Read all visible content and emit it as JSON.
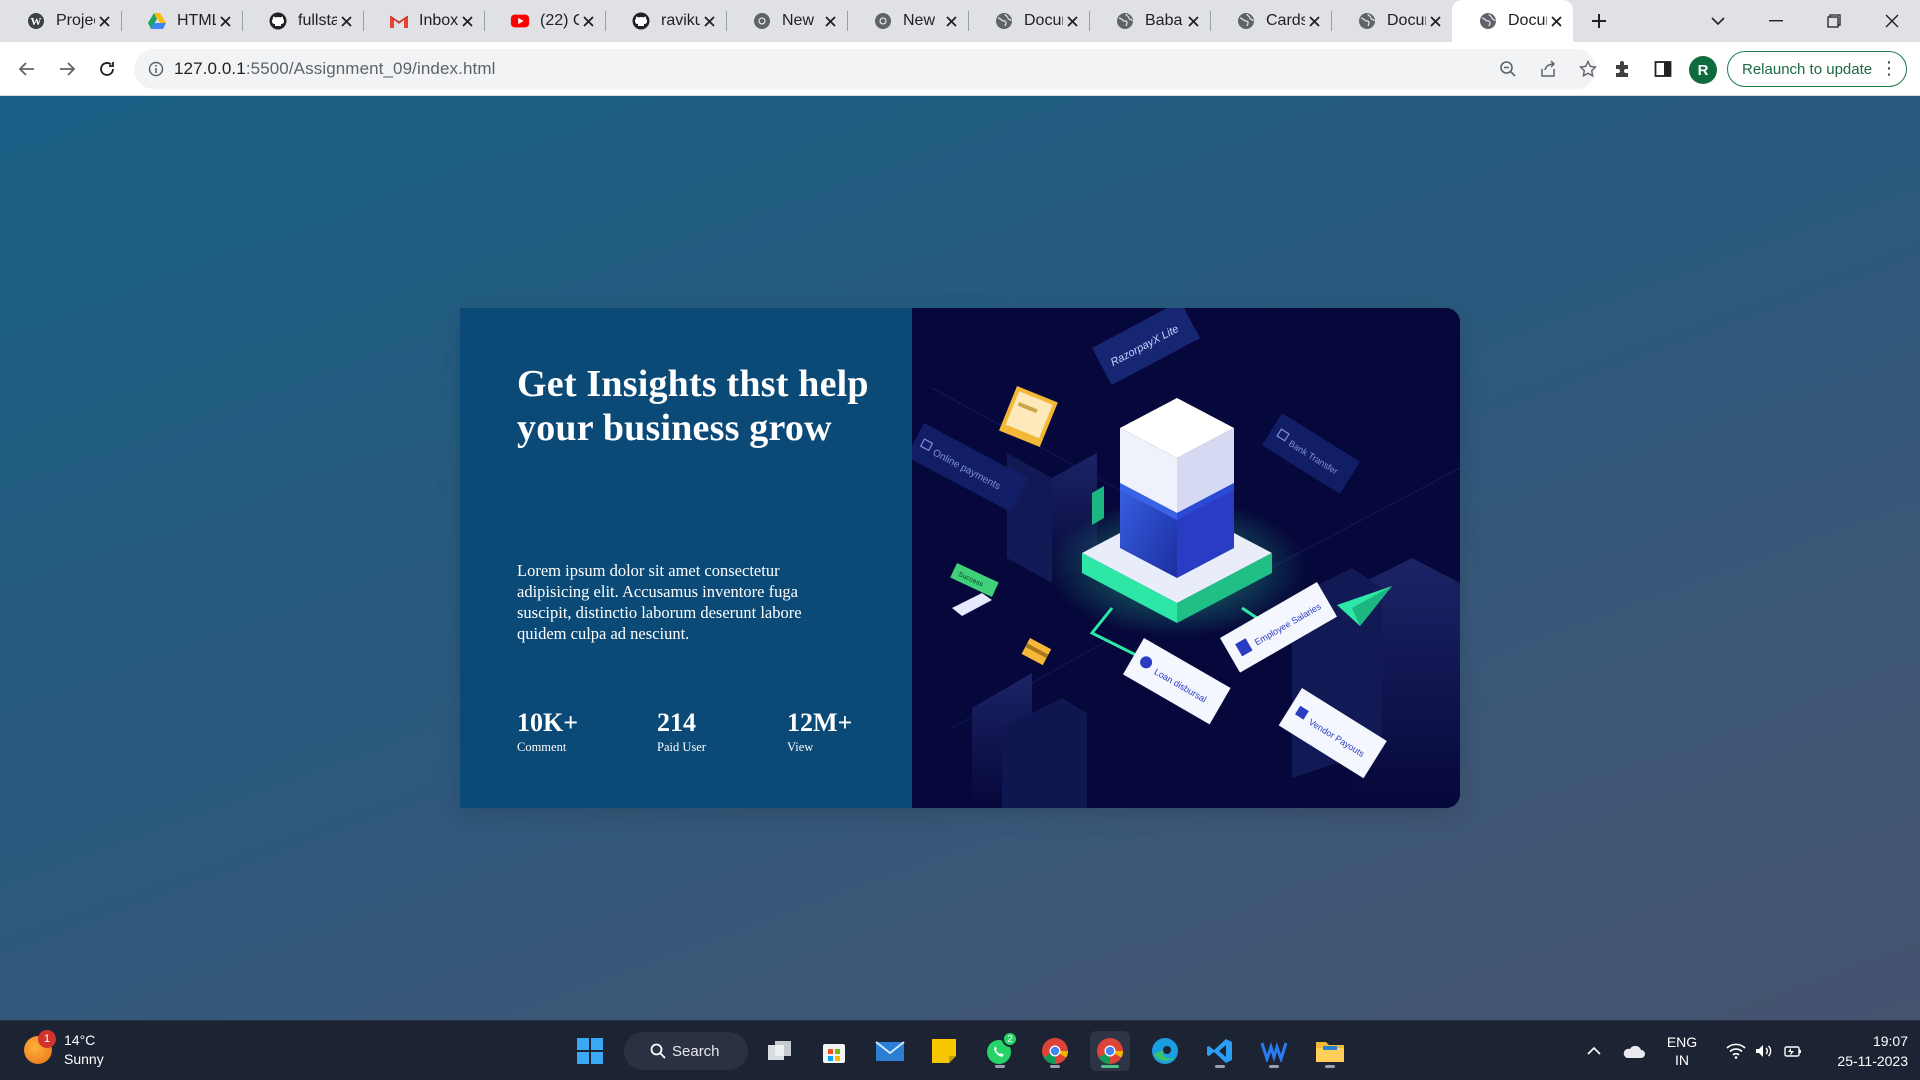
{
  "tabs": [
    {
      "title": "Projects",
      "icon": "wordpress-icon",
      "active": false
    },
    {
      "title": "HTML",
      "icon": "google-drive-icon",
      "active": false
    },
    {
      "title": "fullstack",
      "icon": "github-icon",
      "active": false
    },
    {
      "title": "Inbox",
      "icon": "gmail-icon",
      "active": false
    },
    {
      "title": "(22) C",
      "icon": "youtube-icon",
      "active": false
    },
    {
      "title": "ravikumar",
      "icon": "github-icon",
      "active": false
    },
    {
      "title": "New",
      "icon": "chrome-icon",
      "active": false
    },
    {
      "title": "New",
      "icon": "chrome-icon",
      "active": false
    },
    {
      "title": "Document",
      "icon": "globe-icon",
      "active": false
    },
    {
      "title": "Baba",
      "icon": "globe-icon",
      "active": false
    },
    {
      "title": "Cards",
      "icon": "globe-icon",
      "active": false
    },
    {
      "title": "Document",
      "icon": "globe-icon",
      "active": false
    },
    {
      "title": "Document",
      "icon": "globe-icon",
      "active": true
    }
  ],
  "toolbar": {
    "url_host": "127.0.0.1",
    "url_path": ":5500/Assignment_09/index.html",
    "avatar_letter": "R",
    "relaunch_label": "Relaunch to update"
  },
  "card": {
    "heading": "Get Insights thst help your business grow",
    "paragraph": "Lorem ipsum dolor sit amet consectetur adipisicing elit. Accusamus inventore fuga suscipit, distinctio laborum deserunt labore quidem culpa ad nesciunt.",
    "stats": [
      {
        "value": "10K+",
        "label": "Comment"
      },
      {
        "value": "214",
        "label": "Paid User"
      },
      {
        "value": "12M+",
        "label": "View"
      }
    ]
  },
  "illustration": {
    "labels": {
      "brand": "RazorpayX Lite",
      "online": "Online payments",
      "bank": "Bank Transfer",
      "salaries": "Employee Salaries",
      "loan": "Loan disbursal",
      "vendor": "Vendor Payouts",
      "success": "Success"
    },
    "colors": {
      "bg": "#06073a",
      "accent": "#2ee6a6",
      "panel": "#0b4a77"
    }
  },
  "taskbar": {
    "temperature": "14°C",
    "condition": "Sunny",
    "weather_badge": "1",
    "search_label": "Search",
    "whatsapp_badge": "2",
    "lang_top": "ENG",
    "lang_bottom": "IN",
    "time": "19:07",
    "date": "25-11-2023"
  }
}
